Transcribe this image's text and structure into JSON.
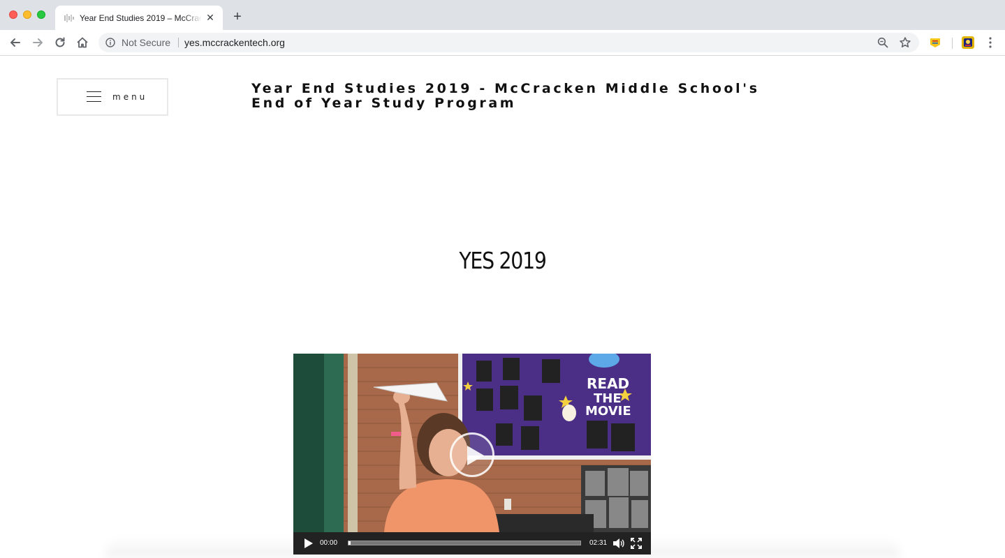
{
  "browser": {
    "tab": {
      "title": "Year End Studies 2019 – McCracken Middle School's End of Year Study Program",
      "close_glyph": "✕"
    },
    "new_tab_glyph": "+",
    "address": {
      "security_label": "Not Secure",
      "url": "yes.mccrackentech.org"
    }
  },
  "site": {
    "menu_label": "menu",
    "title": "Year End Studies 2019 - McCracken Middle School's End of Year Study Program"
  },
  "main": {
    "heading": "YES 2019",
    "video": {
      "current_time": "00:00",
      "duration": "02:31",
      "progress_fraction": 0.01,
      "poster_text": [
        "READ",
        "THE",
        "MOVIE"
      ]
    }
  },
  "colors": {
    "tabbar": "#dee1e6",
    "video_wall_purple": "#4b2f86",
    "shirt": "#f0946a",
    "brick": "#b0714f"
  }
}
